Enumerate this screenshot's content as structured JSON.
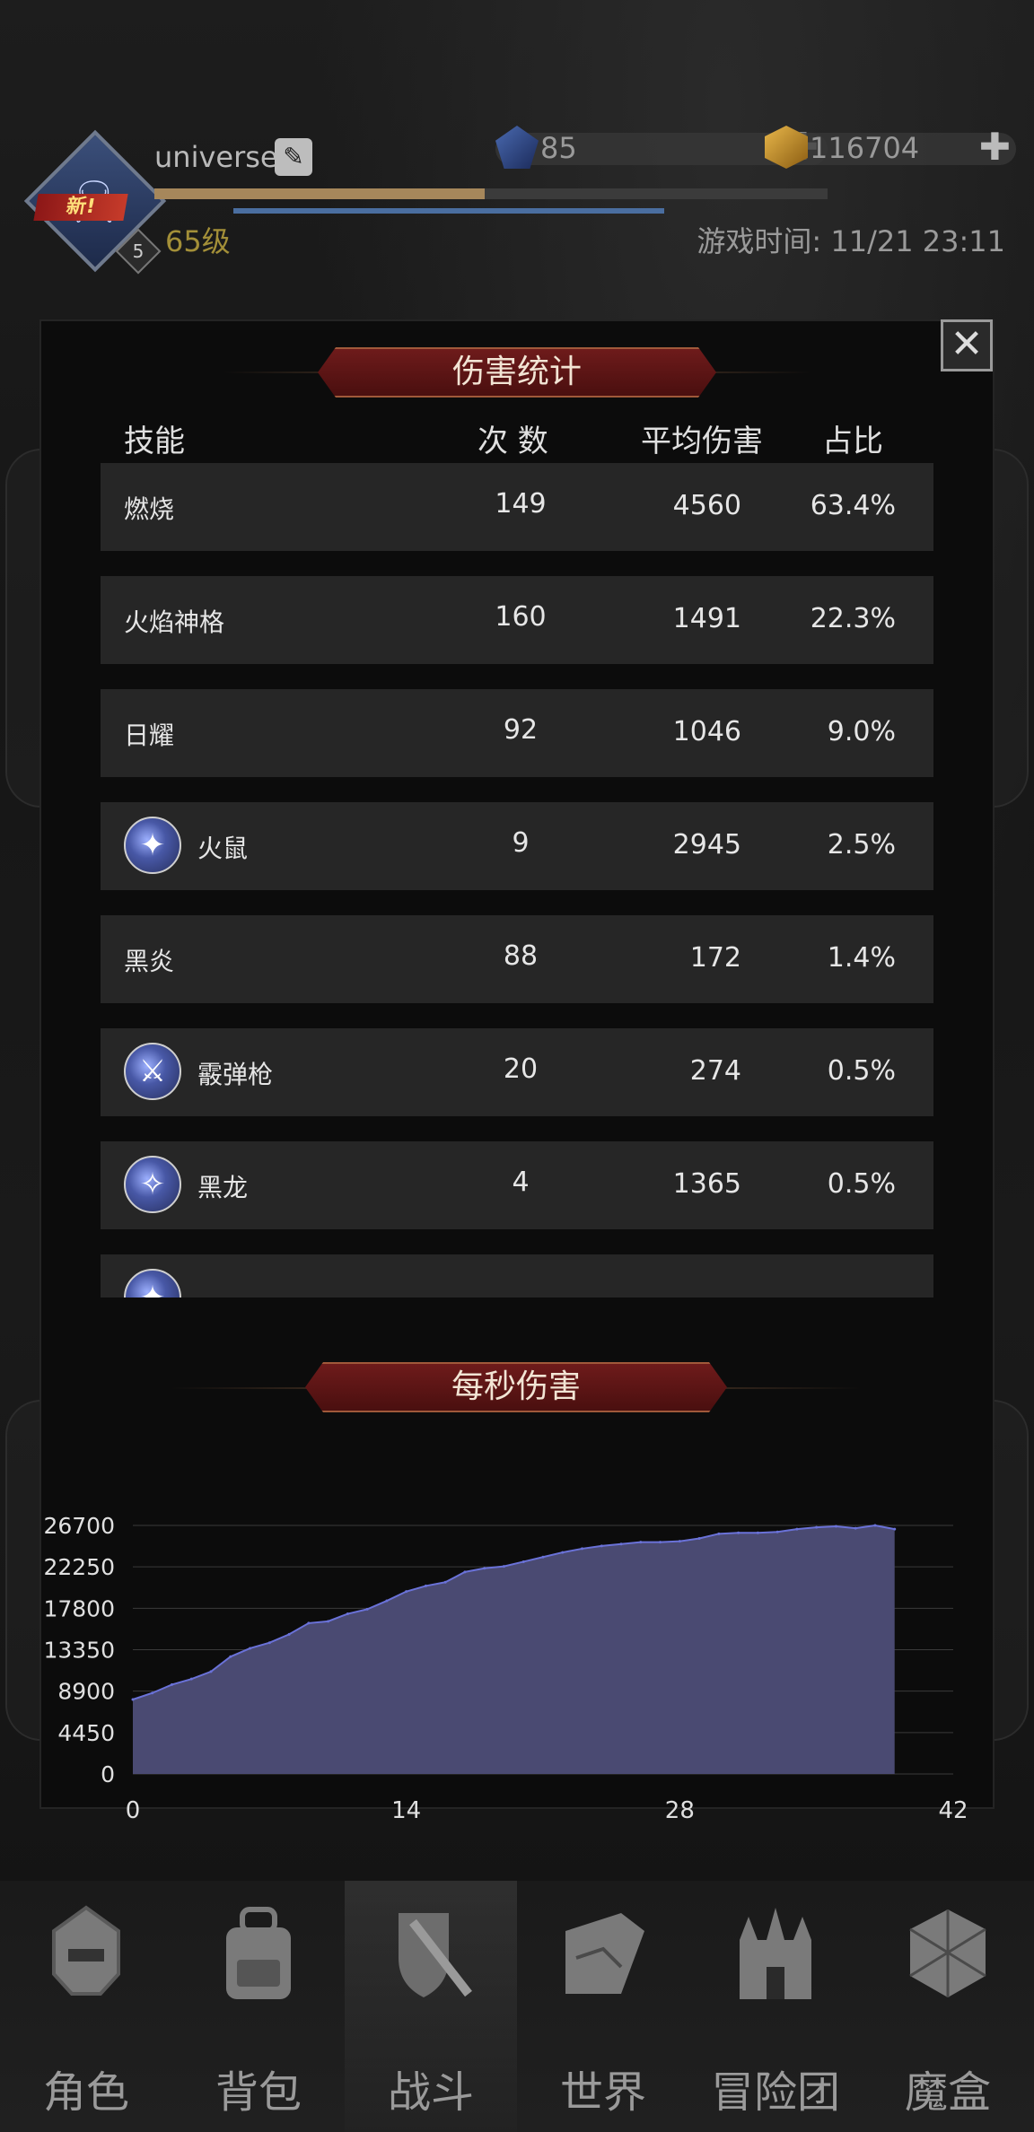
{
  "header": {
    "username": "universe",
    "new_badge": "新!",
    "avatar_level": "5",
    "level": "65级",
    "exp_fraction": 0.49,
    "gems": "85",
    "gold": "116704",
    "game_time": "游戏时间: 11/21 23:11"
  },
  "modal": {
    "title": "伤害统计",
    "close_label": "✕",
    "columns": {
      "skill": "技能",
      "count": "次 数",
      "avg": "平均伤害",
      "pct": "占比"
    },
    "rows": [
      {
        "name": "燃烧",
        "count": "149",
        "avg": "4560",
        "pct": "63.4%",
        "icon": ""
      },
      {
        "name": "火焰神格",
        "count": "160",
        "avg": "1491",
        "pct": "22.3%",
        "icon": ""
      },
      {
        "name": "日耀",
        "count": "92",
        "avg": "1046",
        "pct": "9.0%",
        "icon": ""
      },
      {
        "name": "火鼠",
        "count": "9",
        "avg": "2945",
        "pct": "2.5%",
        "icon": "fire-rat-skill-icon"
      },
      {
        "name": "黑炎",
        "count": "88",
        "avg": "172",
        "pct": "1.4%",
        "icon": ""
      },
      {
        "name": "霰弹枪",
        "count": "20",
        "avg": "274",
        "pct": "0.5%",
        "icon": "shotgun-skill-icon"
      },
      {
        "name": "黑龙",
        "count": "4",
        "avg": "1365",
        "pct": "0.5%",
        "icon": "black-dragon-skill-icon"
      },
      {
        "name": "",
        "count": "",
        "avg": "",
        "pct": "",
        "icon": "partial-skill-icon"
      }
    ],
    "dps_title": "每秒伤害"
  },
  "chart_data": {
    "type": "area",
    "title": "每秒伤害",
    "x": [
      0,
      1,
      2,
      3,
      4,
      5,
      6,
      7,
      8,
      9,
      10,
      11,
      12,
      13,
      14,
      15,
      16,
      17,
      18,
      19,
      20,
      21,
      22,
      23,
      24,
      25,
      26,
      27,
      28,
      29,
      30,
      31,
      32,
      33,
      34,
      35,
      36,
      37,
      38,
      39
    ],
    "values": [
      8000,
      8700,
      9600,
      10200,
      11000,
      12600,
      13500,
      14100,
      15000,
      16200,
      16400,
      17200,
      17700,
      18600,
      19600,
      20200,
      20600,
      21700,
      22100,
      22300,
      22800,
      23300,
      23800,
      24200,
      24500,
      24700,
      24900,
      24900,
      25000,
      25300,
      25800,
      25900,
      25900,
      26000,
      26300,
      26500,
      26600,
      26400,
      26700,
      26300
    ],
    "yticks": [
      0,
      4450,
      8900,
      13350,
      17800,
      22250,
      26700
    ],
    "xticks": [
      0,
      14,
      28,
      42
    ],
    "xlim": [
      0,
      42
    ],
    "ylim": [
      0,
      26700
    ],
    "fill_color": "#4a4a72",
    "line_color": "#6a72d8"
  },
  "nav": [
    {
      "label": "角色",
      "icon": "helmet-icon",
      "active": false
    },
    {
      "label": "背包",
      "icon": "backpack-icon",
      "active": false
    },
    {
      "label": "战斗",
      "icon": "sword-shield-icon",
      "active": true
    },
    {
      "label": "世界",
      "icon": "map-scroll-icon",
      "active": false
    },
    {
      "label": "冒险团",
      "icon": "castle-icon",
      "active": false
    },
    {
      "label": "魔盒",
      "icon": "magic-cube-icon",
      "active": false
    }
  ],
  "colors": {
    "banner": "#6e1b1b",
    "row_bg": "#262626",
    "level_text": "#a38f38"
  }
}
